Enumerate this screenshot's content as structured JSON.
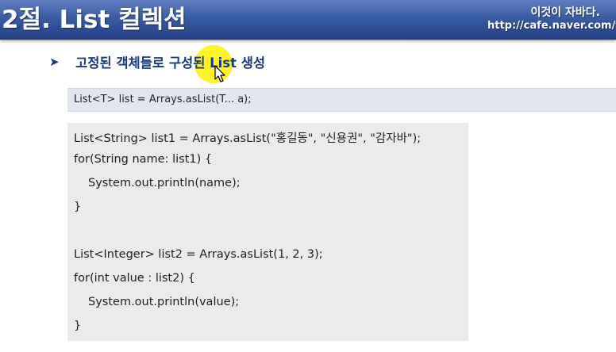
{
  "header": {
    "title": "2절. List 컬렉션",
    "slogan": "이것이 자바다.",
    "url": "http://cafe.naver.com/this"
  },
  "bullet": {
    "arrow": "➤",
    "text": "고정된 객체들로 구성된 List 생성"
  },
  "signature": {
    "code": "List<T> list = Arrays.asList(T...  a);"
  },
  "code": {
    "lines": [
      "List<String>  list1  =  Arrays.asList(\"홍길동\",   \"신용권\",  \"감자바\");",
      "for(String  name: list1) {",
      "System.out.println(name);",
      "}",
      "",
      "List<Integer>  list2  =  Arrays.asList(1,  2,  3);",
      "for(int value : list2) {",
      "System.out.println(value);",
      "}"
    ]
  },
  "colors": {
    "header_bg": "#3a5ca3",
    "bullet_text": "#1a3a7a",
    "highlight": "#fff000",
    "signature_bg": "#e2e7ef",
    "code_bg": "#ebebeb"
  }
}
